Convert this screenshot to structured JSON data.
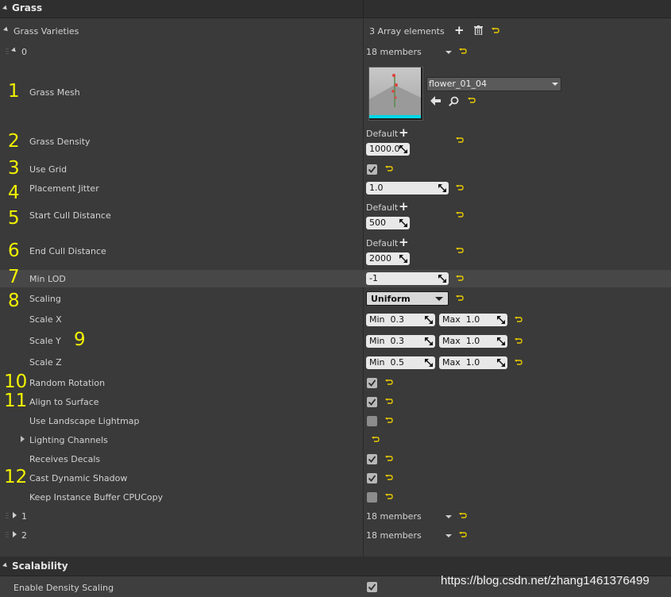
{
  "colors": {
    "panel_bg": "#3a3a3a",
    "header_bg": "#2f2f2f",
    "annotation": "#f2f200",
    "reset_arrow": "#e6c800",
    "thumb_accent": "#00d8e8"
  },
  "grass": {
    "header": "Grass",
    "varieties_label": "Grass Varieties",
    "array_count": "3 Array elements",
    "item0": {
      "index": "0",
      "members": "18 members"
    },
    "item1": {
      "index": "1",
      "members": "18 members"
    },
    "item2": {
      "index": "2",
      "members": "18 members"
    }
  },
  "properties": {
    "grass_mesh": {
      "num": "1",
      "label": "Grass Mesh",
      "asset": "flower_01_04"
    },
    "grass_density": {
      "num": "2",
      "label": "Grass Density",
      "default": "Default",
      "value": "1000.0"
    },
    "use_grid": {
      "num": "3",
      "label": "Use Grid",
      "checked": true
    },
    "placement_jitter": {
      "num": "4",
      "label": "Placement Jitter",
      "value": "1.0"
    },
    "start_cull": {
      "num": "5",
      "label": "Start Cull Distance",
      "default": "Default",
      "value": "500"
    },
    "end_cull": {
      "num": "6",
      "label": "End Cull Distance",
      "default": "Default",
      "value": "2000"
    },
    "min_lod": {
      "num": "7",
      "label": "Min LOD",
      "value": "-1"
    },
    "scaling": {
      "num": "8",
      "label": "Scaling",
      "value": "Uniform"
    },
    "scale_num": "9",
    "scale_x": {
      "label": "Scale X",
      "min_label": "Min",
      "min": "0.3",
      "max_label": "Max",
      "max": "1.0"
    },
    "scale_y": {
      "label": "Scale Y",
      "min_label": "Min",
      "min": "0.3",
      "max_label": "Max",
      "max": "1.0"
    },
    "scale_z": {
      "label": "Scale Z",
      "min_label": "Min",
      "min": "0.5",
      "max_label": "Max",
      "max": "1.0"
    },
    "random_rotation": {
      "num": "10",
      "label": "Random Rotation",
      "checked": true
    },
    "align_surface": {
      "num": "11",
      "label": "Align to Surface",
      "checked": true
    },
    "landscape_lightmap": {
      "label": "Use Landscape Lightmap",
      "checked": false
    },
    "lighting_channels": {
      "label": "Lighting Channels"
    },
    "receives_decals": {
      "label": "Receives Decals",
      "checked": true
    },
    "cast_shadow": {
      "num": "12",
      "label": "Cast Dynamic Shadow",
      "checked": true
    },
    "keep_cpu_copy": {
      "label": "Keep Instance Buffer CPUCopy",
      "checked": false
    }
  },
  "scalability": {
    "header": "Scalability",
    "density_scaling": {
      "label": "Enable Density Scaling",
      "checked": true
    }
  },
  "watermark": "https://blog.csdn.net/zhang1461376499"
}
